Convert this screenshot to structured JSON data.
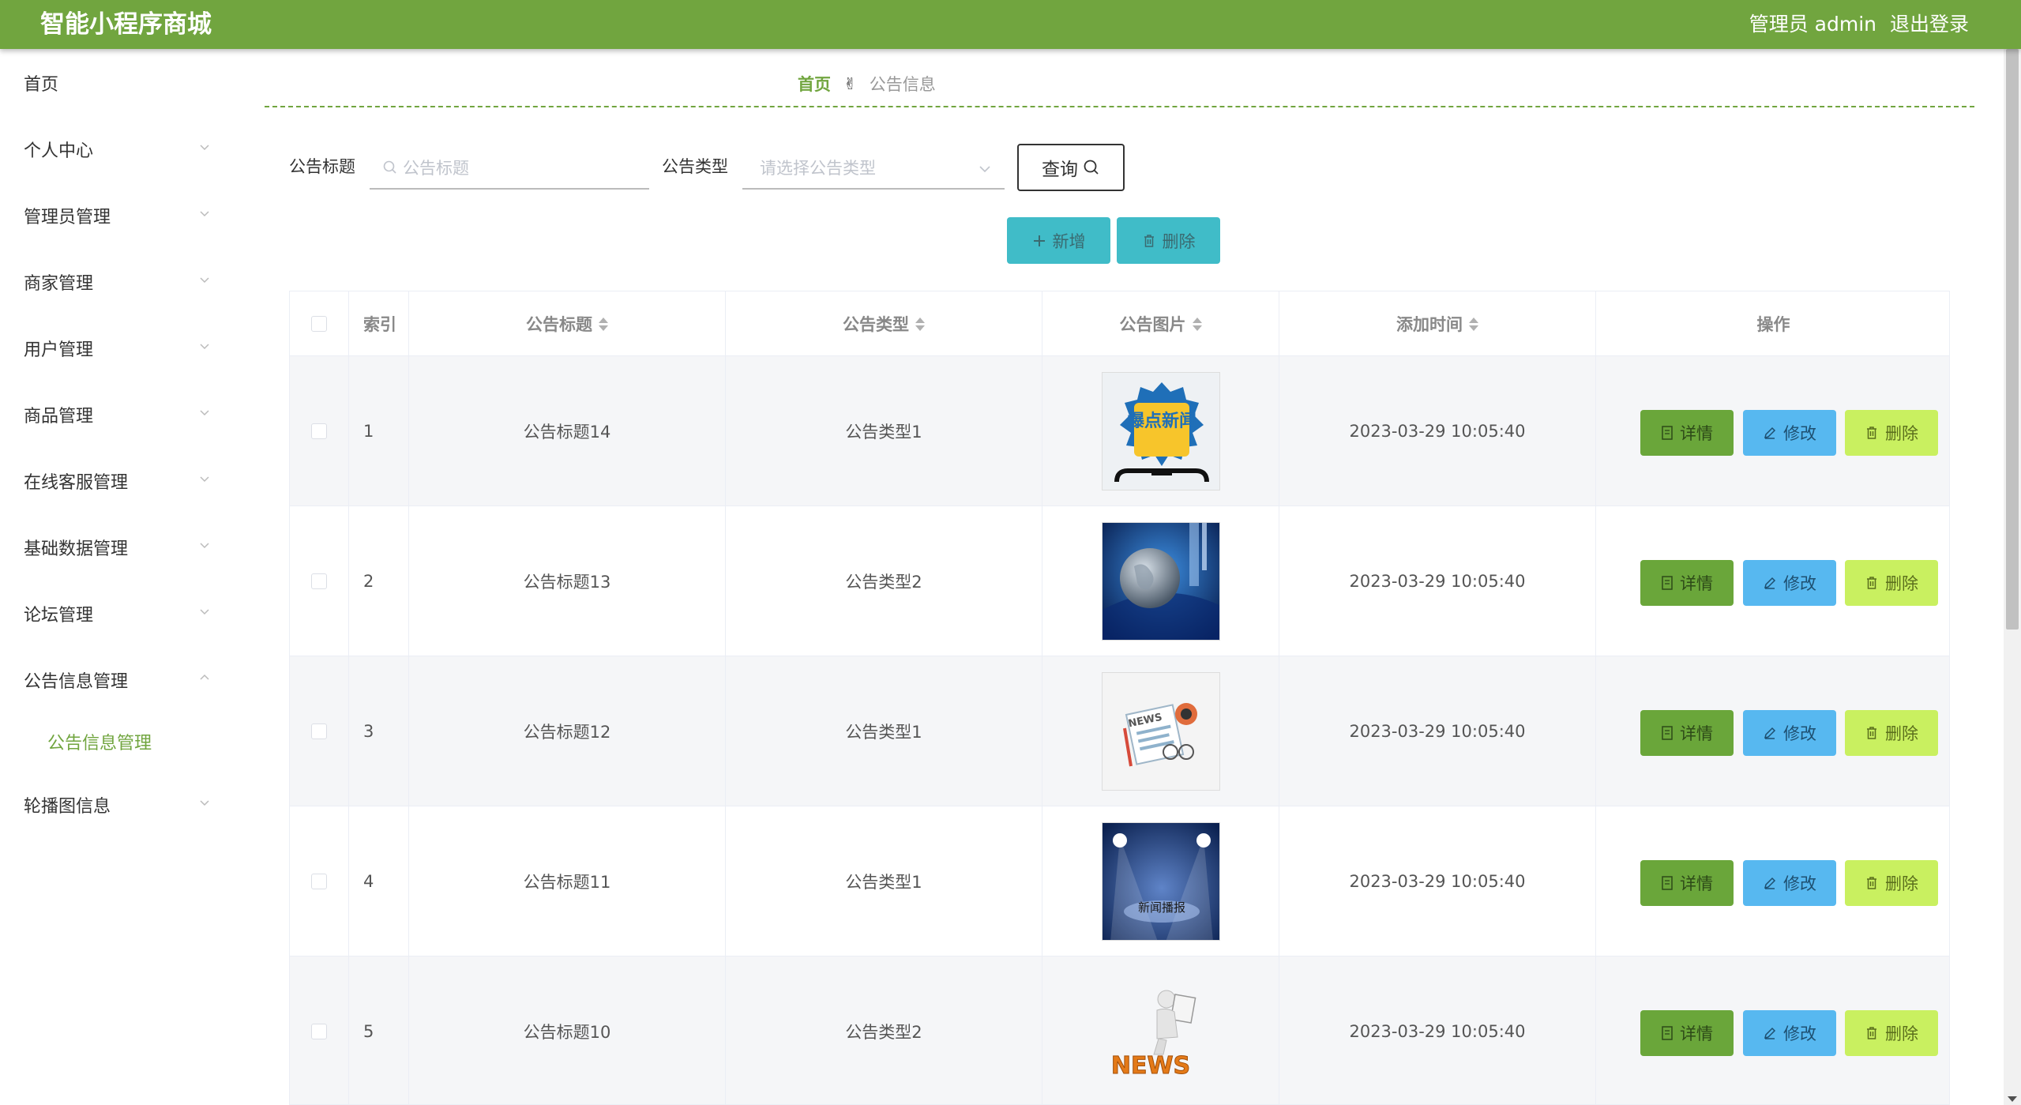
{
  "header": {
    "app_title": "智能小程序商城",
    "admin_label": "管理员 admin",
    "logout": "退出登录"
  },
  "sidebar": {
    "items": [
      {
        "label": "首页",
        "has_arrow": false
      },
      {
        "label": "个人中心",
        "has_arrow": true
      },
      {
        "label": "管理员管理",
        "has_arrow": true
      },
      {
        "label": "商家管理",
        "has_arrow": true
      },
      {
        "label": "用户管理",
        "has_arrow": true
      },
      {
        "label": "商品管理",
        "has_arrow": true
      },
      {
        "label": "在线客服管理",
        "has_arrow": true
      },
      {
        "label": "基础数据管理",
        "has_arrow": true
      },
      {
        "label": "论坛管理",
        "has_arrow": true
      },
      {
        "label": "公告信息管理",
        "has_arrow": true,
        "expanded": true
      },
      {
        "label": "公告信息管理",
        "sub": true,
        "active": true
      },
      {
        "label": "轮播图信息",
        "has_arrow": true
      }
    ]
  },
  "breadcrumb": {
    "home": "首页",
    "separator": "✌",
    "current": "公告信息"
  },
  "search": {
    "title_label": "公告标题",
    "title_placeholder": "公告标题",
    "type_label": "公告类型",
    "type_placeholder": "请选择公告类型",
    "query_button": "查询"
  },
  "actions": {
    "add": "新增",
    "delete": "删除"
  },
  "table": {
    "columns": [
      "索引",
      "公告标题",
      "公告类型",
      "公告图片",
      "添加时间",
      "操作"
    ],
    "rows": [
      {
        "index": "1",
        "title": "公告标题14",
        "type": "公告类型1",
        "image": "爆点新闻",
        "time": "2023-03-29 10:05:40"
      },
      {
        "index": "2",
        "title": "公告标题13",
        "type": "公告类型2",
        "image": "globe-news",
        "time": "2023-03-29 10:05:40"
      },
      {
        "index": "3",
        "title": "公告标题12",
        "type": "公告类型1",
        "image": "NEWS",
        "time": "2023-03-29 10:05:40"
      },
      {
        "index": "4",
        "title": "公告标题11",
        "type": "公告类型1",
        "image": "新闻播报",
        "time": "2023-03-29 10:05:40"
      },
      {
        "index": "5",
        "title": "公告标题10",
        "type": "公告类型2",
        "image": "NEWS",
        "time": "2023-03-29 10:05:40"
      }
    ],
    "row_buttons": {
      "detail": "详情",
      "edit": "修改",
      "delete": "删除"
    }
  },
  "colors": {
    "primary": "#71a53f",
    "teal": "#40bcc8",
    "detail": "#6aa63a",
    "edit": "#57b8f0",
    "delete": "#c9f060"
  }
}
